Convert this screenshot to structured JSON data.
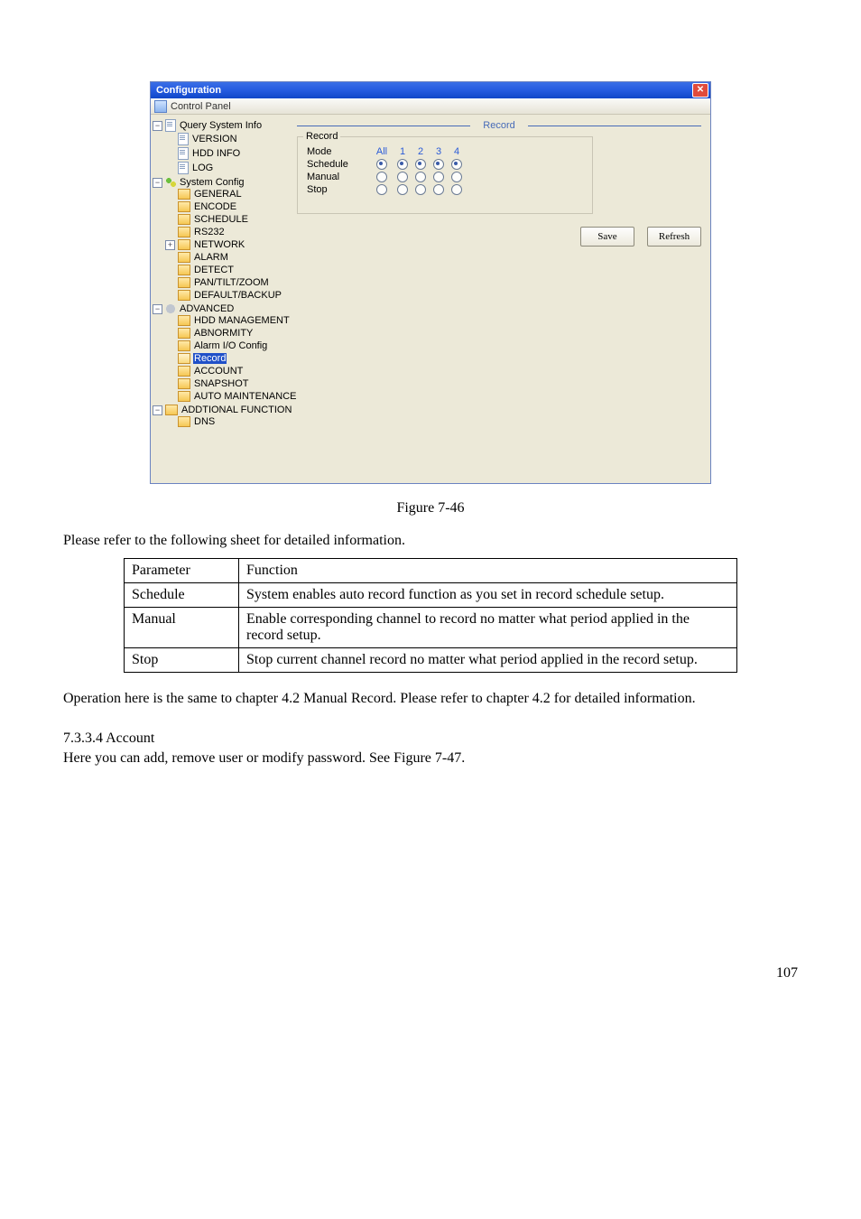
{
  "win": {
    "title": "Configuration",
    "control_panel": "Control Panel",
    "header_label": "Record",
    "group_legend": "Record",
    "rows": {
      "mode": "Mode",
      "all": "All",
      "ch1": "1",
      "ch2": "2",
      "ch3": "3",
      "ch4": "4",
      "schedule": "Schedule",
      "manual": "Manual",
      "stop": "Stop"
    },
    "buttons": {
      "save": "Save",
      "refresh": "Refresh"
    },
    "tree": {
      "qsi": "Query System Info",
      "version": "VERSION",
      "hdd": "HDD INFO",
      "log": "LOG",
      "sysc": "System Config",
      "general": "GENERAL",
      "encode": "ENCODE",
      "schedule": "SCHEDULE",
      "rs232": "RS232",
      "network": "NETWORK",
      "alarm": "ALARM",
      "detect": "DETECT",
      "ptz": "PAN/TILT/ZOOM",
      "defb": "DEFAULT/BACKUP",
      "adv": "ADVANCED",
      "hddm": "HDD MANAGEMENT",
      "abn": "ABNORMITY",
      "aio": "Alarm I/O Config",
      "record": "Record",
      "account": "ACCOUNT",
      "snapshot": "SNAPSHOT",
      "automaint": "AUTO MAINTENANCE",
      "addfn": "ADDTIONAL FUNCTION",
      "dns": "DNS"
    }
  },
  "doc": {
    "fig": "Figure 7-46",
    "introline": "Please refer to the following sheet for detailed information.",
    "th_param": "Parameter",
    "th_func": "Function",
    "r1p": "Schedule",
    "r1f": "System enables auto record function as you set in record schedule setup.",
    "r2p": "Manual",
    "r2f": "Enable corresponding channel to record no matter what period applied in the record setup.",
    "r3p": "Stop",
    "r3f": "Stop current channel record no matter what period applied in the record setup.",
    "oper": "Operation here is the same to chapter 4.2 Manual Record. Please refer to chapter 4.2 for detailed information.",
    "sect_no": "7.3.3.4  Account",
    "sect_txt": "Here you can add, remove user or modify password. See Figure 7-47.",
    "pageno": "107"
  }
}
